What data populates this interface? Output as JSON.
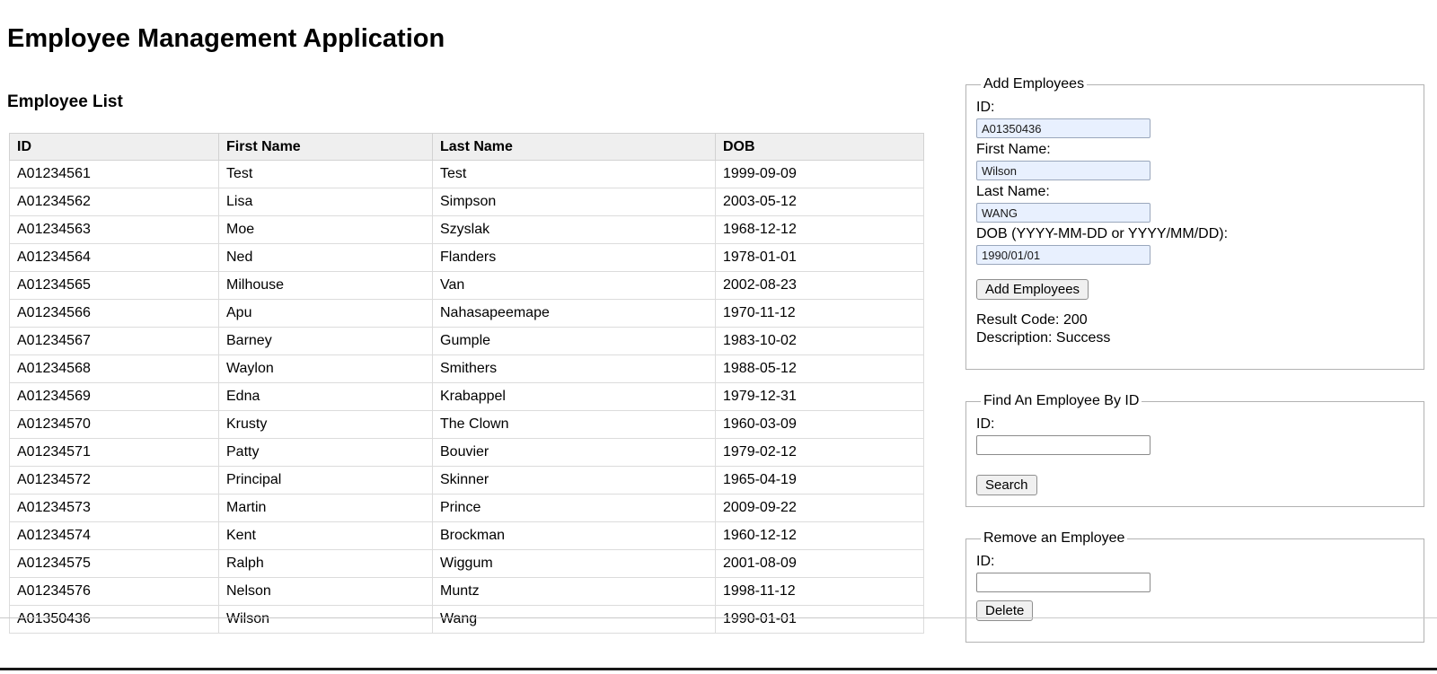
{
  "page": {
    "title": "Employee Management Application"
  },
  "employee_list": {
    "heading": "Employee List",
    "columns": [
      "ID",
      "First Name",
      "Last Name",
      "DOB"
    ],
    "rows": [
      [
        "A01234561",
        "Test",
        "Test",
        "1999-09-09"
      ],
      [
        "A01234562",
        "Lisa",
        "Simpson",
        "2003-05-12"
      ],
      [
        "A01234563",
        "Moe",
        "Szyslak",
        "1968-12-12"
      ],
      [
        "A01234564",
        "Ned",
        "Flanders",
        "1978-01-01"
      ],
      [
        "A01234565",
        "Milhouse",
        "Van",
        "2002-08-23"
      ],
      [
        "A01234566",
        "Apu",
        "Nahasapeemape",
        "1970-11-12"
      ],
      [
        "A01234567",
        "Barney",
        "Gumple",
        "1983-10-02"
      ],
      [
        "A01234568",
        "Waylon",
        "Smithers",
        "1988-05-12"
      ],
      [
        "A01234569",
        "Edna",
        "Krabappel",
        "1979-12-31"
      ],
      [
        "A01234570",
        "Krusty",
        "The Clown",
        "1960-03-09"
      ],
      [
        "A01234571",
        "Patty",
        "Bouvier",
        "1979-02-12"
      ],
      [
        "A01234572",
        "Principal",
        "Skinner",
        "1965-04-19"
      ],
      [
        "A01234573",
        "Martin",
        "Prince",
        "2009-09-22"
      ],
      [
        "A01234574",
        "Kent",
        "Brockman",
        "1960-12-12"
      ],
      [
        "A01234575",
        "Ralph",
        "Wiggum",
        "2001-08-09"
      ],
      [
        "A01234576",
        "Nelson",
        "Muntz",
        "1998-11-12"
      ],
      [
        "A01350436",
        "Wilson",
        "Wang",
        "1990-01-01"
      ]
    ]
  },
  "add_employees": {
    "legend": "Add Employees",
    "id_label": "ID:",
    "id_value": "A01350436",
    "first_name_label": "First Name:",
    "first_name_value": "Wilson",
    "last_name_label": "Last Name:",
    "last_name_value": "WANG",
    "dob_label": "DOB (YYYY-MM-DD or YYYY/MM/DD):",
    "dob_value": "1990/01/01",
    "button_label": "Add Employees",
    "result_code_text": "Result Code: 200",
    "description_text": "Description: Success"
  },
  "find_employee": {
    "legend": "Find An Employee By ID",
    "id_label": "ID:",
    "id_value": "",
    "button_label": "Search"
  },
  "remove_employee": {
    "legend": "Remove an Employee",
    "id_label": "ID:",
    "id_value": "",
    "button_label": "Delete"
  },
  "colors": {
    "autofill_input_bg": "#e8f0fe",
    "table_header_bg": "#efefef",
    "table_border": "#dcdcdc",
    "button_bg": "#f0f0f0",
    "bottom_bar": "#181818"
  }
}
